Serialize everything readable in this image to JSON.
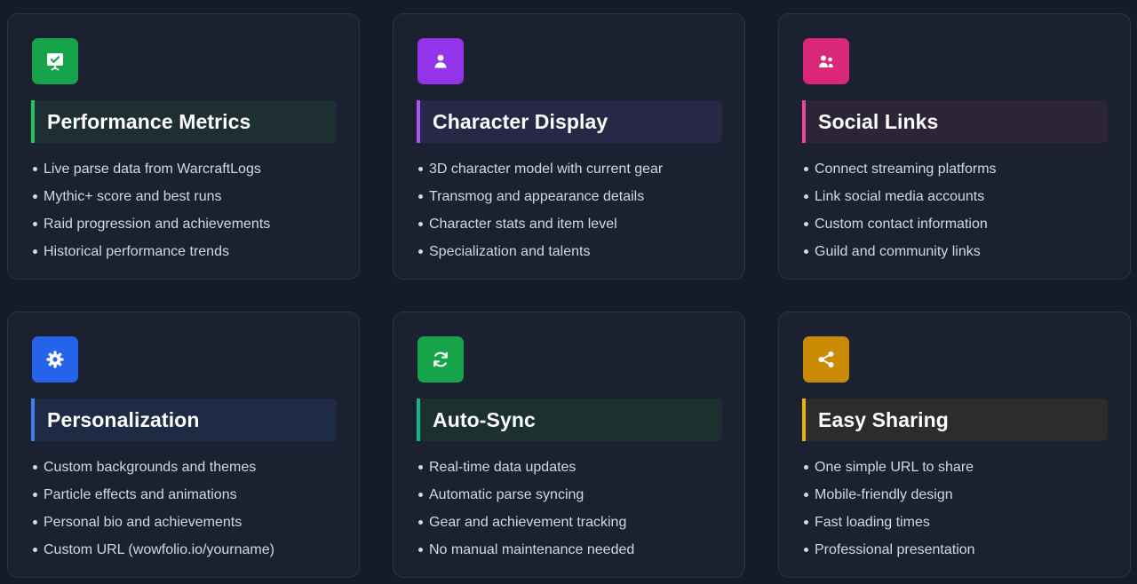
{
  "cards": [
    {
      "icon": "presentation-check-icon",
      "accent": "#22c55e",
      "icon_bg": "#16a34a",
      "title_bg": "#1e2f34",
      "title": "Performance Metrics",
      "features": [
        "Live parse data from WarcraftLogs",
        "Mythic+ score and best runs",
        "Raid progression and achievements",
        "Historical performance trends"
      ]
    },
    {
      "icon": "user-icon",
      "accent": "#a855f7",
      "icon_bg": "#9333ea",
      "title_bg": "#272846",
      "title": "Character Display",
      "features": [
        "3D character model with current gear",
        "Transmog and appearance details",
        "Character stats and item level",
        "Specialization and talents"
      ]
    },
    {
      "icon": "users-icon",
      "accent": "#ec4899",
      "icon_bg": "#db2777",
      "title_bg": "#2c2538",
      "title": "Social Links",
      "features": [
        "Connect streaming platforms",
        "Link social media accounts",
        "Custom contact information",
        "Guild and community links"
      ]
    },
    {
      "icon": "gear-icon",
      "accent": "#3b82f6",
      "icon_bg": "#2563eb",
      "title_bg": "#1f2b44",
      "title": "Personalization",
      "features": [
        "Custom backgrounds and themes",
        "Particle effects and animations",
        "Personal bio and achievements",
        "Custom URL (wowfolio.io/yourname)"
      ]
    },
    {
      "icon": "sync-icon",
      "accent": "#10b981",
      "icon_bg": "#16a34a",
      "title_bg": "#1d3030",
      "title": "Auto-Sync",
      "features": [
        "Real-time data updates",
        "Automatic parse syncing",
        "Gear and achievement tracking",
        "No manual maintenance needed"
      ]
    },
    {
      "icon": "share-icon",
      "accent": "#eab308",
      "icon_bg": "#ca8a04",
      "title_bg": "#2c2c2c",
      "title": "Easy Sharing",
      "features": [
        "One simple URL to share",
        "Mobile-friendly design",
        "Fast loading times",
        "Professional presentation"
      ]
    }
  ]
}
